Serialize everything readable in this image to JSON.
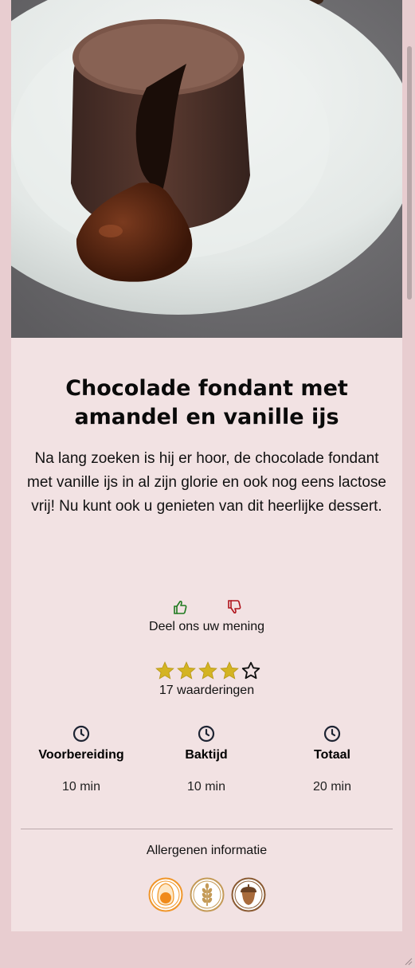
{
  "recipe": {
    "title": "Chocolade fondant met amandel en vanille ijs",
    "description": "Na lang zoeken is hij er hoor, de chocolade fondant met vanille ijs in al zijn glorie en ook nog eens lactose vrij! Nu kunt ook u genieten van dit heerlijke dessert."
  },
  "feedback": {
    "prompt": "Deel ons uw mening",
    "like_icon": "thumbs-up-icon",
    "dislike_icon": "thumbs-down-icon",
    "like_color": "#1f7a1f",
    "dislike_color": "#b0141c"
  },
  "rating": {
    "value": 4,
    "max": 5,
    "count_text": "17 waarderingen",
    "star_color": "#d4b422"
  },
  "times": [
    {
      "label": "Voorbereiding",
      "value": "10 min",
      "icon": "clock-icon"
    },
    {
      "label": "Baktijd",
      "value": "10 min",
      "icon": "clock-icon"
    },
    {
      "label": "Totaal",
      "value": "20 min",
      "icon": "clock-icon"
    }
  ],
  "allergens": {
    "title": "Allergenen informatie",
    "items": [
      {
        "name": "egg",
        "icon": "egg-icon",
        "color": "#f0962a"
      },
      {
        "name": "gluten",
        "icon": "wheat-icon",
        "color": "#c49a57"
      },
      {
        "name": "nuts",
        "icon": "acorn-icon",
        "color": "#8a5a32"
      }
    ]
  },
  "colors": {
    "page_background": "#e8cdd0",
    "card_background": "#f2e2e3"
  }
}
